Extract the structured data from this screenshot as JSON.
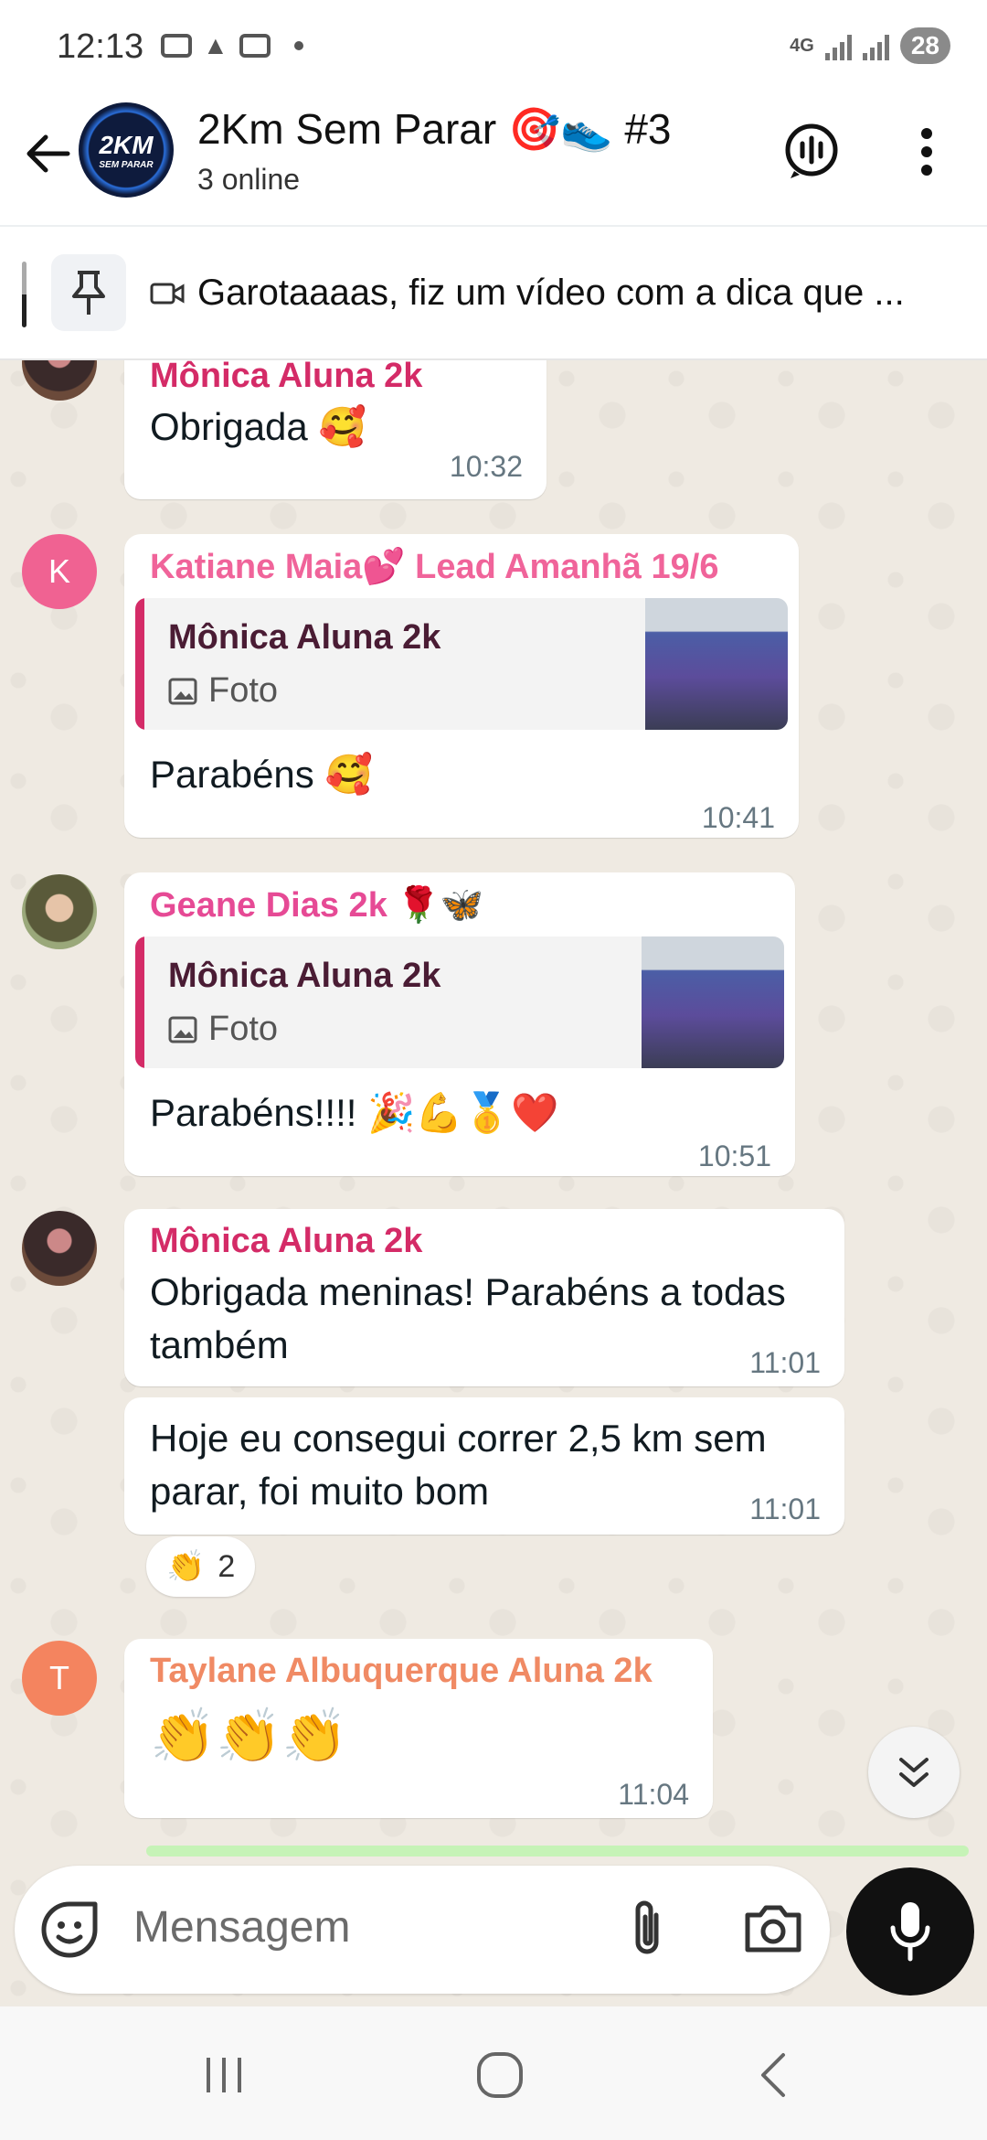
{
  "status_bar": {
    "time": "12:13",
    "network": "4G",
    "battery": "28"
  },
  "header": {
    "avatar_line1": "2KM",
    "avatar_line2": "SEM PARAR",
    "title": "2Km Sem Parar 🎯👟 #3",
    "subtitle": "3 online"
  },
  "pinned": {
    "text": "Garotaaaas, fiz um vídeo com a dica que ..."
  },
  "messages": [
    {
      "sender": "Mônica Aluna 2k",
      "text": "Obrigada 🥰",
      "time": "10:32",
      "sender_color": "#d42b67"
    },
    {
      "sender": "Katiane Maia💕 Lead Amanhã 19/6",
      "avatar_letter": "K",
      "quote_name": "Mônica Aluna 2k",
      "quote_type": "Foto",
      "text": "Parabéns 🥰",
      "time": "10:41",
      "sender_color": "#f0649a"
    },
    {
      "sender": "Geane Dias 2k 🌹🦋",
      "quote_name": "Mônica Aluna 2k",
      "quote_type": "Foto",
      "text": "Parabéns!!!! 🎉💪🥇❤️",
      "time": "10:51",
      "sender_color": "#e64a95"
    },
    {
      "sender": "Mônica Aluna 2k",
      "text": "Obrigada meninas! Parabéns a todas também",
      "time": "11:01",
      "sender_color": "#d42b67"
    },
    {
      "text": "Hoje eu consegui correr 2,5 km sem parar, foi muito bom",
      "time": "11:01",
      "reaction_emoji": "👏",
      "reaction_count": "2"
    },
    {
      "sender": "Taylane Albuquerque Aluna 2k",
      "avatar_letter": "T",
      "text": "👏👏👏",
      "time": "11:04",
      "sender_color": "#f08a64"
    }
  ],
  "composer": {
    "placeholder": "Mensagem"
  },
  "colors": {
    "chat_bg": "#efeae2",
    "bubble": "#ffffff",
    "quote_accent": "#d42b67",
    "avatar_k": "#f06292",
    "avatar_t": "#f4845f"
  }
}
